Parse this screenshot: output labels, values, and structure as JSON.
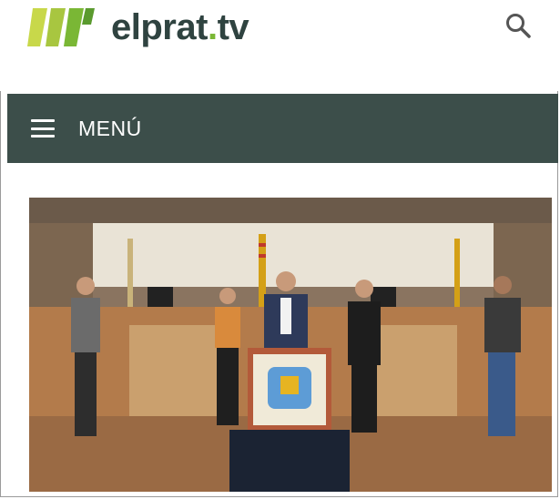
{
  "header": {
    "logo_text": "elprat",
    "logo_dot": ".",
    "logo_suffix": "tv",
    "logo_icon": "elprat-logo-icon",
    "search_icon": "search-icon"
  },
  "nav": {
    "menu_icon": "hamburger-menu-icon",
    "menu_label": "MENÚ"
  },
  "colors": {
    "brand_dark": "#2f4340",
    "brand_green": "#7ab735",
    "nav_bg": "#3c4e4a"
  }
}
